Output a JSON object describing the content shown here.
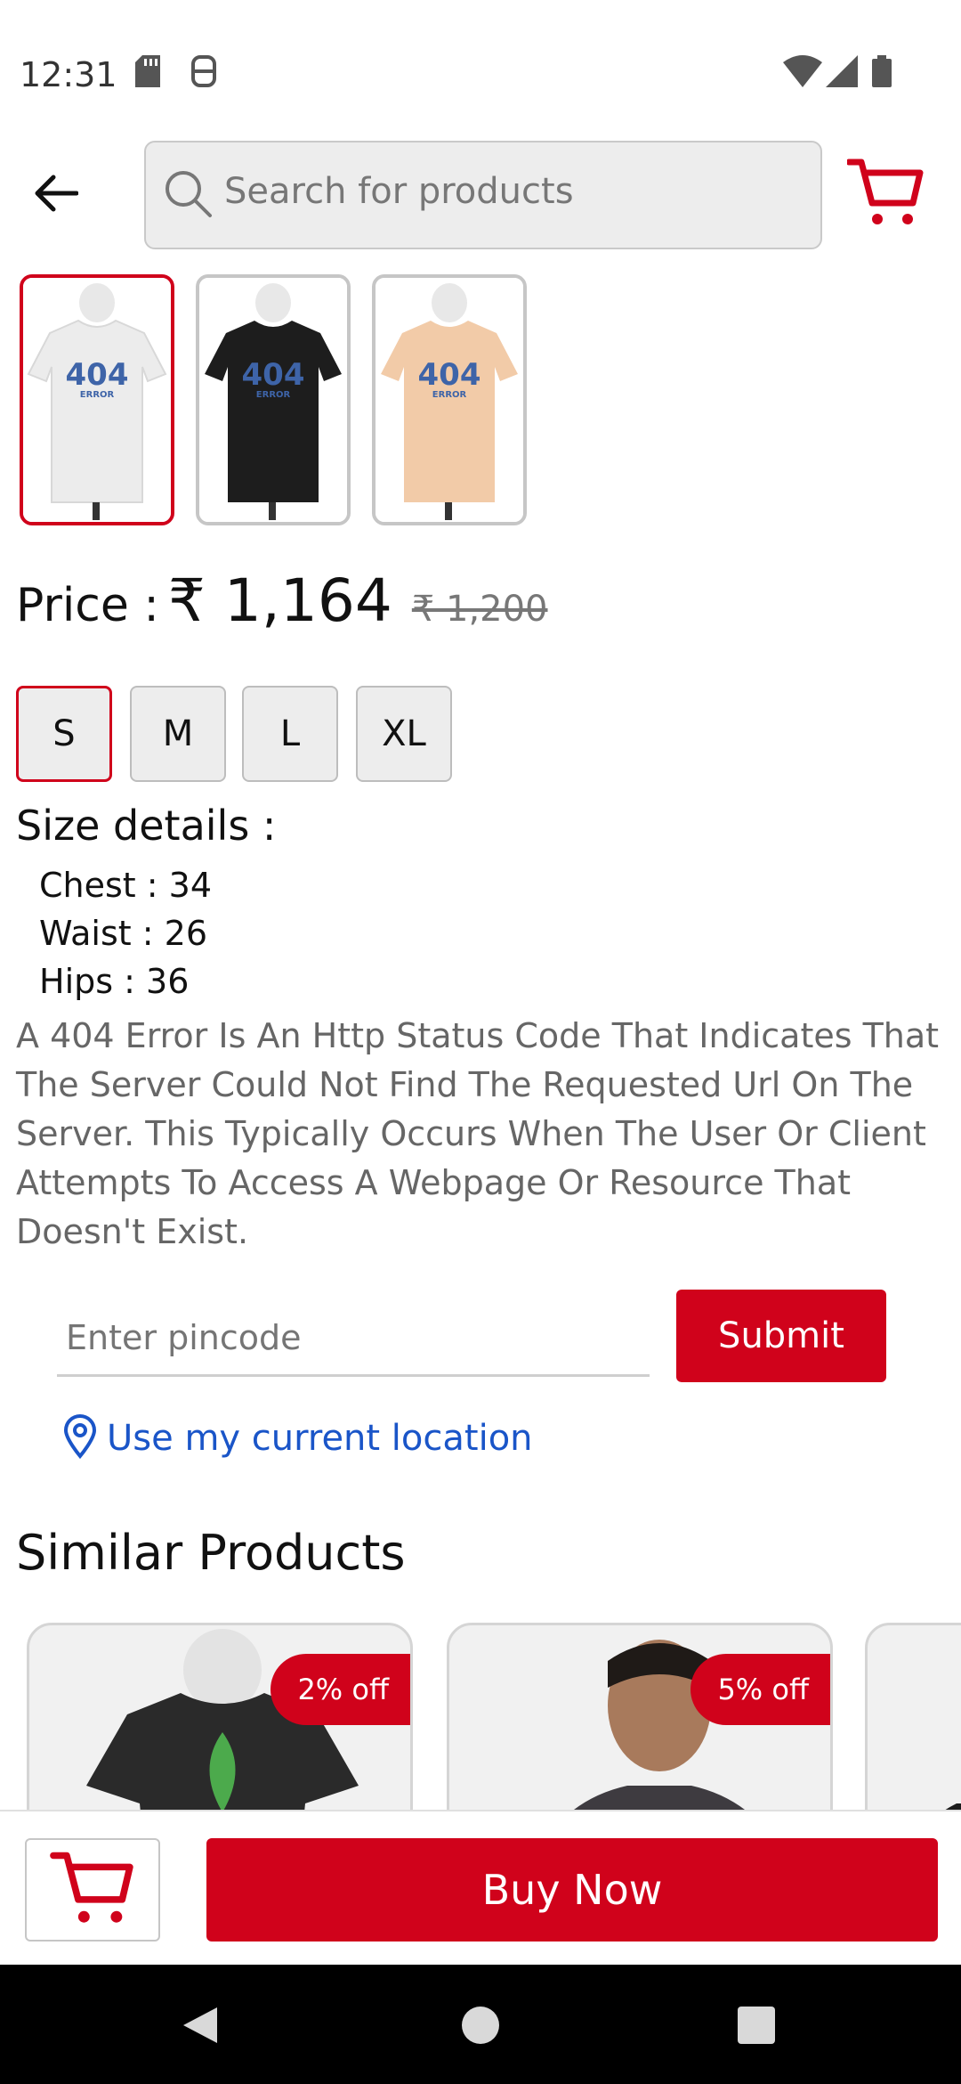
{
  "status_bar": {
    "time": "12:31"
  },
  "header": {
    "back_icon": "arrow-left-icon",
    "search_placeholder": "Search for products",
    "cart_icon": "shopping-cart-icon"
  },
  "product": {
    "thumbnails": [
      {
        "color": "#ececec",
        "print": "404",
        "subtext": "ERROR",
        "selected": true
      },
      {
        "color": "#1d1d1d",
        "print": "404",
        "subtext": "ERROR",
        "selected": false
      },
      {
        "color": "#f2cba8",
        "print": "404",
        "subtext": "ERROR",
        "selected": false
      }
    ],
    "price_label": "Price :",
    "price_current": "₹ 1,164",
    "price_old": "₹ 1,200",
    "sizes": [
      "S",
      "M",
      "L",
      "XL"
    ],
    "selected_size": "S",
    "size_details_title": "Size details :",
    "size_details": [
      "Chest : 34",
      "Waist : 26",
      "Hips : 36"
    ],
    "description": "A 404 Error Is An Http Status Code That Indicates That The Server Could Not Find The Requested Url On The Server. This Typically Occurs When The User Or Client Attempts To Access A Webpage Or Resource That Doesn't Exist."
  },
  "pincode": {
    "placeholder": "Enter pincode",
    "submit_label": "Submit",
    "location_label": "Use my current location"
  },
  "similar": {
    "title": "Similar Products",
    "items": [
      {
        "discount": "2% off"
      },
      {
        "discount": "5% off"
      }
    ]
  },
  "bottom": {
    "buy_now_label": "Buy Now"
  },
  "colors": {
    "accent": "#d0021b",
    "link": "#1a55c8"
  }
}
